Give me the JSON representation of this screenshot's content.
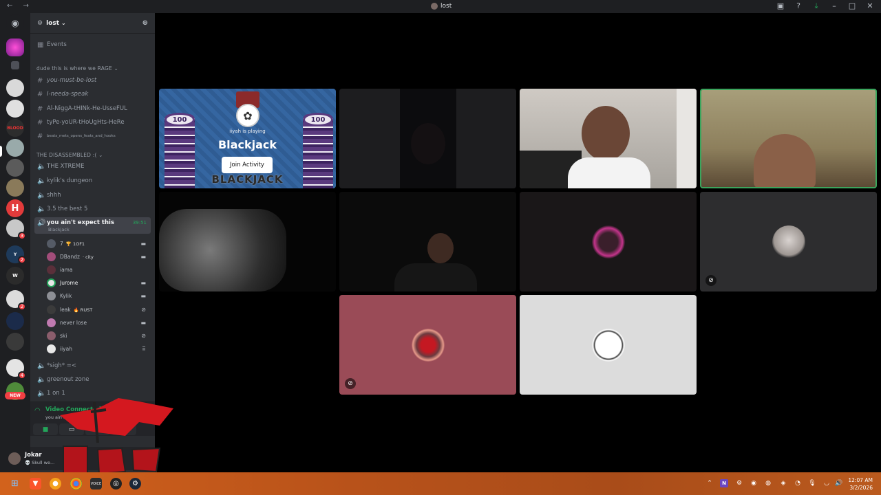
{
  "titlebar": {
    "title": "lost",
    "nav": "← →"
  },
  "server": {
    "name": "lost"
  },
  "events_label": "Events",
  "categories": [
    {
      "label": "dude this is where we RAGE ⌄"
    },
    {
      "label": "THE DISASSEMBLED :( ⌄"
    }
  ],
  "text_channels": [
    {
      "label": "you-must-be-lost"
    },
    {
      "label": "I-needa-speak"
    },
    {
      "label": "Al-NiggA-tHINk-He-UsseFUL"
    },
    {
      "label": "tyPe-yoUR-tHoUgHts-HeRe"
    },
    {
      "label": "beats_mets_opens_feats_and_hooks"
    }
  ],
  "voice_channels": [
    {
      "label": "THE XTREME"
    },
    {
      "label": "kylik's dungeon"
    },
    {
      "label": "shhh"
    },
    {
      "label": "3.5 the best 5"
    }
  ],
  "active_channel": {
    "label": "you ain't expect this",
    "timer": "39:51",
    "sub": "Blackjack"
  },
  "voice_users": [
    {
      "name": "7",
      "extra": "🏆 1OF1",
      "color": "#555b66",
      "status": "▬"
    },
    {
      "name": "DBandz",
      "extra": "· city",
      "color": "#a24d7a",
      "status": "▬"
    },
    {
      "name": "iama",
      "extra": "",
      "color": "#5a2f3a",
      "status": ""
    },
    {
      "name": "Jurome",
      "extra": "",
      "color": "#e7e7e7",
      "status": "▬"
    },
    {
      "name": "Kylik",
      "extra": "",
      "color": "#8d8f95",
      "status": "▬"
    },
    {
      "name": "leak",
      "extra": "🔥 RUST",
      "color": "#3b3b3b",
      "status": "⊘"
    },
    {
      "name": "never lose",
      "extra": "",
      "color": "#c07ab0",
      "status": "▬"
    },
    {
      "name": "ski",
      "extra": "",
      "color": "#8b5d6c",
      "status": "⊘"
    },
    {
      "name": "iiyah",
      "extra": "",
      "color": "#e8e8e8",
      "status": "⠿"
    }
  ],
  "voice_channels_after": [
    {
      "label": "*sigh* =<"
    },
    {
      "label": "greenout zone"
    },
    {
      "label": "1 on 1"
    }
  ],
  "voice_connected": {
    "label": "Video Connected",
    "channel": "you ain't expect this"
  },
  "user": {
    "name": "Jokar",
    "status": "💀 Skull we..."
  },
  "server_badges": {
    "b1": "3",
    "b2": "2",
    "b3": "2",
    "b4": "4",
    "new": "NEW"
  },
  "activity": {
    "playing": "iiyah is playing",
    "game": "Blackjack",
    "join": "Join Activity",
    "chip": "100",
    "watermark": "BLACKJACK"
  },
  "clock": {
    "time": "12:07 AM",
    "date": "3/2/2026"
  },
  "colors": {
    "accent_green": "#23a55a",
    "sidebar": "#2b2d31",
    "servers": "#1e1f22",
    "taskbar": "#c25a1c",
    "speaking_border": "#3ba55d"
  }
}
